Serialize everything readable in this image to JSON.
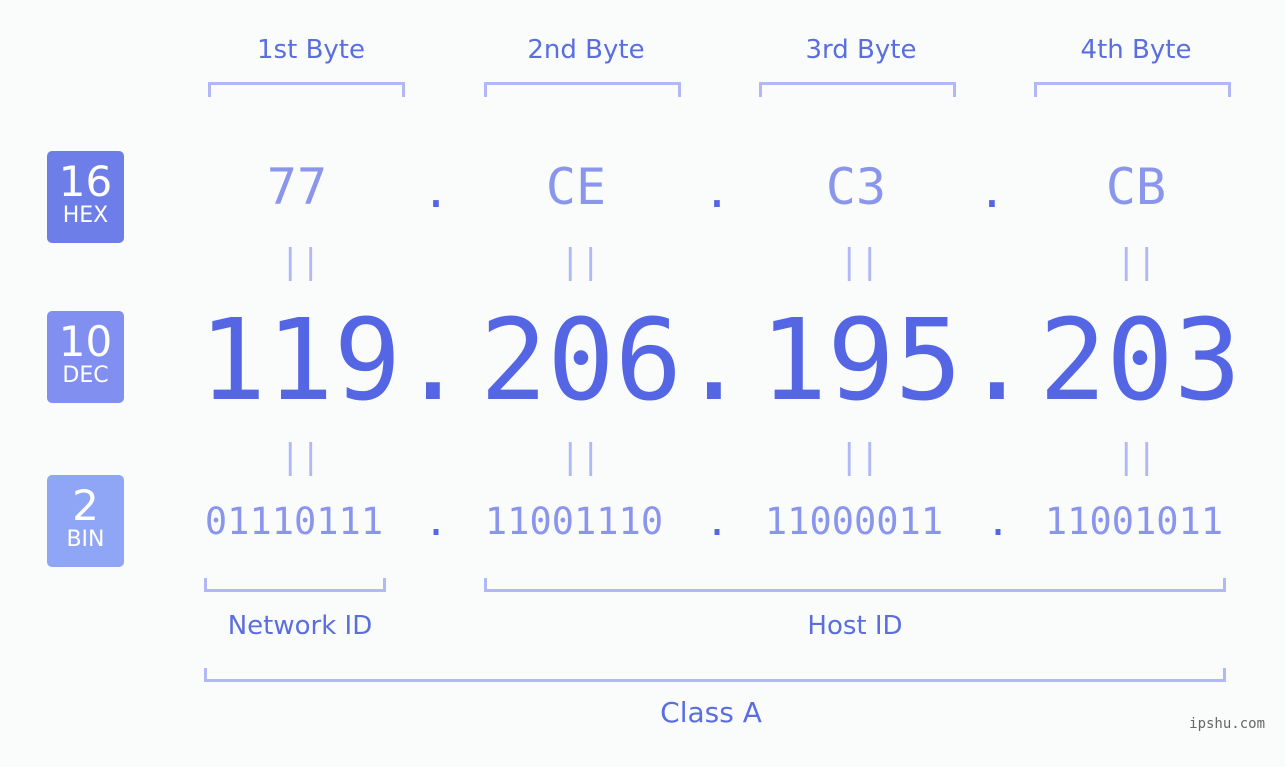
{
  "bases": [
    {
      "number": "16",
      "label": "HEX",
      "color": "#6e7ee8"
    },
    {
      "number": "10",
      "label": "DEC",
      "color": "#8190f0"
    },
    {
      "number": "2",
      "label": "BIN",
      "color": "#8fa5f6"
    }
  ],
  "byte_headers": [
    "1st Byte",
    "2nd Byte",
    "3rd Byte",
    "4th Byte"
  ],
  "hex": [
    "77",
    "CE",
    "C3",
    "CB"
  ],
  "dec": [
    "119",
    "206",
    "195",
    "203"
  ],
  "bin": [
    "01110111",
    "11001110",
    "11000011",
    "11001011"
  ],
  "separator": ".",
  "equals": "||",
  "network_id_label": "Network ID",
  "host_id_label": "Host ID",
  "class_label": "Class A",
  "watermark": "ipshu.com",
  "colors": {
    "accent": "#5466e4",
    "light": "#8a95ec",
    "bracket": "#b0b9f5"
  }
}
